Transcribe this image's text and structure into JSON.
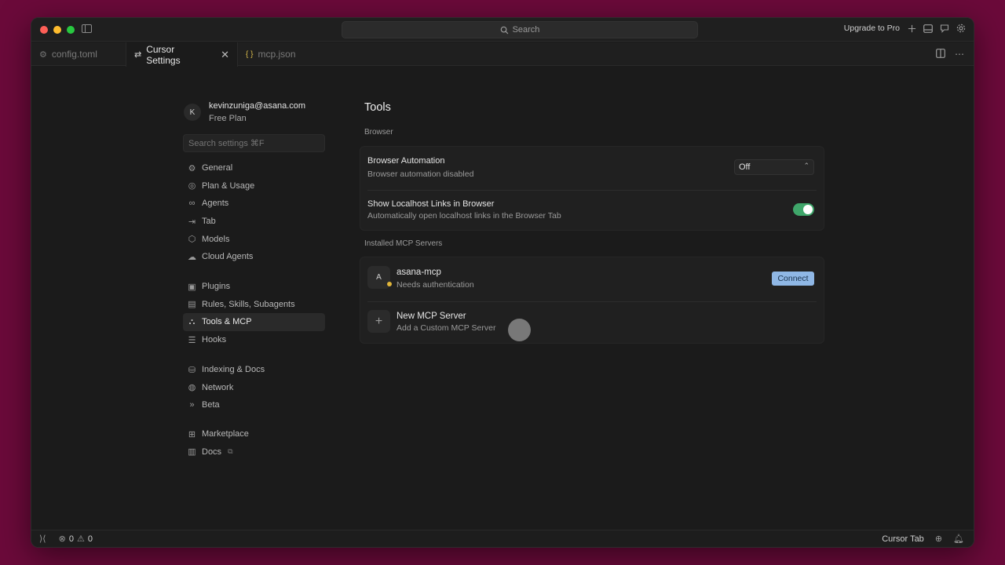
{
  "titlebar": {
    "search_label": "Search",
    "upgrade_label": "Upgrade to Pro"
  },
  "tabs": [
    {
      "label": "config.toml",
      "icon": "gear-icon"
    },
    {
      "label": "Cursor Settings",
      "icon": "settings-sliders-icon",
      "active": true
    },
    {
      "label": "mcp.json",
      "icon": "json-braces-icon"
    }
  ],
  "profile": {
    "initial": "K",
    "email": "kevinzuniga@asana.com",
    "plan": "Free Plan"
  },
  "settings_search": {
    "placeholder": "Search settings ⌘F"
  },
  "nav": {
    "group1": [
      {
        "label": "General",
        "icon": "gear-icon"
      },
      {
        "label": "Plan & Usage",
        "icon": "plan-icon"
      },
      {
        "label": "Agents",
        "icon": "infinity-icon"
      },
      {
        "label": "Tab",
        "icon": "tab-arrow-icon"
      },
      {
        "label": "Models",
        "icon": "cube-icon"
      },
      {
        "label": "Cloud Agents",
        "icon": "cloud-icon"
      }
    ],
    "group2": [
      {
        "label": "Plugins",
        "icon": "plugin-icon"
      },
      {
        "label": "Rules, Skills, Subagents",
        "icon": "document-icon"
      },
      {
        "label": "Tools & MCP",
        "icon": "network-nodes-icon",
        "active": true
      },
      {
        "label": "Hooks",
        "icon": "hooks-icon"
      }
    ],
    "group3": [
      {
        "label": "Indexing & Docs",
        "icon": "database-icon"
      },
      {
        "label": "Network",
        "icon": "globe-icon"
      },
      {
        "label": "Beta",
        "icon": "chevrons-right-icon"
      }
    ],
    "group4": [
      {
        "label": "Marketplace",
        "icon": "marketplace-icon"
      },
      {
        "label": "Docs",
        "icon": "book-icon"
      }
    ]
  },
  "main": {
    "title": "Tools",
    "browser_section": "Browser",
    "browser_automation": {
      "title": "Browser Automation",
      "description": "Browser automation disabled",
      "select_value": "Off"
    },
    "localhost_links": {
      "title": "Show Localhost Links in Browser",
      "description": "Automatically open localhost links in the Browser Tab",
      "enabled": true
    },
    "mcp_section": "Installed MCP Servers",
    "servers": [
      {
        "initial": "A",
        "name": "asana-mcp",
        "status": "Needs authentication",
        "status_color": "#e0b53a",
        "action": "Connect"
      }
    ],
    "new_server": {
      "title": "New MCP Server",
      "description": "Add a Custom MCP Server"
    }
  },
  "statusbar": {
    "errors": "0",
    "warnings": "0",
    "cursor_tab": "Cursor Tab"
  },
  "colors": {
    "accent_toggle": "#3fa66a",
    "connect_button": "#8fb7e5",
    "background": "#6b0a3a"
  }
}
